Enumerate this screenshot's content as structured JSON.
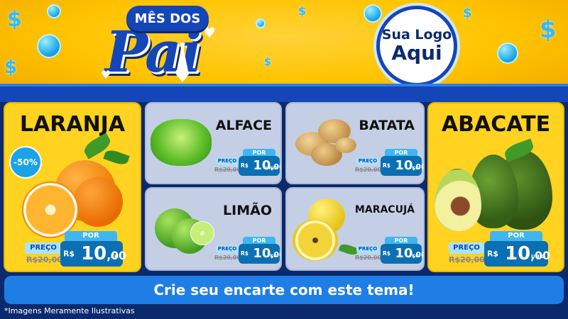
{
  "header": {
    "badge_text": "MÊS DOS",
    "title_script": "Pai",
    "logo_line1": "Sua Logo",
    "logo_line2": "Aqui"
  },
  "products": [
    {
      "name": "LARANJA",
      "discount": "-50%",
      "preco_label": "PREÇO",
      "old_price": "R$20,00",
      "por_label": "POR",
      "currency": "R$",
      "price_int": "10",
      "price_cents": ",00",
      "unit": "KG"
    },
    {
      "name": "ALFACE",
      "preco_label": "PREÇO",
      "old_price": "R$20,00",
      "por_label": "POR",
      "currency": "R$",
      "price_int": "10",
      "price_cents": ",00",
      "unit": "UNID"
    },
    {
      "name": "BATATA",
      "preco_label": "PREÇO",
      "old_price": "R$20,00",
      "por_label": "POR",
      "currency": "R$",
      "price_int": "10",
      "price_cents": ",00",
      "unit": "KG"
    },
    {
      "name": "ABACATE",
      "preco_label": "PREÇO",
      "old_price": "R$20,00",
      "por_label": "POR",
      "currency": "R$",
      "price_int": "10",
      "price_cents": ",00",
      "unit": "UNID"
    },
    {
      "name": "LIMÃO",
      "preco_label": "PREÇO",
      "old_price": "R$20,00",
      "por_label": "POR",
      "currency": "R$",
      "price_int": "10",
      "price_cents": ",00",
      "unit": "KG"
    },
    {
      "name": "MARACUJÁ",
      "preco_label": "PREÇO",
      "old_price": "R$20,00",
      "por_label": "POR",
      "currency": "R$",
      "price_int": "10",
      "price_cents": ",00",
      "unit": "KG"
    }
  ],
  "cta_text": "Crie seu encarte com este tema!",
  "footer_note": "*Imagens Meramente Ilustrativas",
  "colors": {
    "banner_yellow": "#ffc400",
    "brand_blue": "#1546b8",
    "price_blue": "#0b6fb3",
    "tag_light": "#3fb6ef"
  }
}
